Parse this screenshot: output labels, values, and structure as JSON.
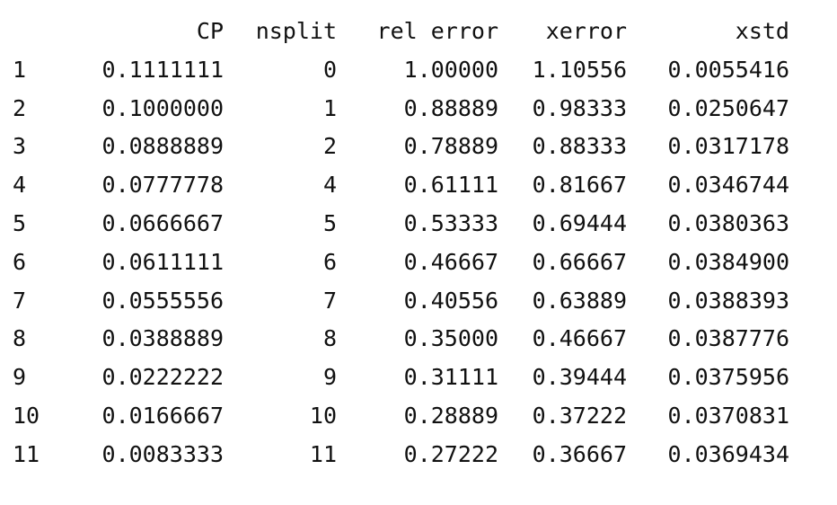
{
  "table": {
    "headers": [
      "",
      "CP",
      "nsplit",
      "rel error",
      "xerror",
      "xstd"
    ],
    "rows": [
      [
        "1",
        "0.1111111",
        "0",
        "1.00000",
        "1.10556",
        "0.0055416"
      ],
      [
        "2",
        "0.1000000",
        "1",
        "0.88889",
        "0.98333",
        "0.0250647"
      ],
      [
        "3",
        "0.0888889",
        "2",
        "0.78889",
        "0.88333",
        "0.0317178"
      ],
      [
        "4",
        "0.0777778",
        "4",
        "0.61111",
        "0.81667",
        "0.0346744"
      ],
      [
        "5",
        "0.0666667",
        "5",
        "0.53333",
        "0.69444",
        "0.0380363"
      ],
      [
        "6",
        "0.0611111",
        "6",
        "0.46667",
        "0.66667",
        "0.0384900"
      ],
      [
        "7",
        "0.0555556",
        "7",
        "0.40556",
        "0.63889",
        "0.0388393"
      ],
      [
        "8",
        "0.0388889",
        "8",
        "0.35000",
        "0.46667",
        "0.0387776"
      ],
      [
        "9",
        "0.0222222",
        "9",
        "0.31111",
        "0.39444",
        "0.0375956"
      ],
      [
        "10",
        "0.0166667",
        "10",
        "0.28889",
        "0.37222",
        "0.0370831"
      ],
      [
        "11",
        "0.0083333",
        "11",
        "0.27222",
        "0.36667",
        "0.0369434"
      ]
    ]
  }
}
